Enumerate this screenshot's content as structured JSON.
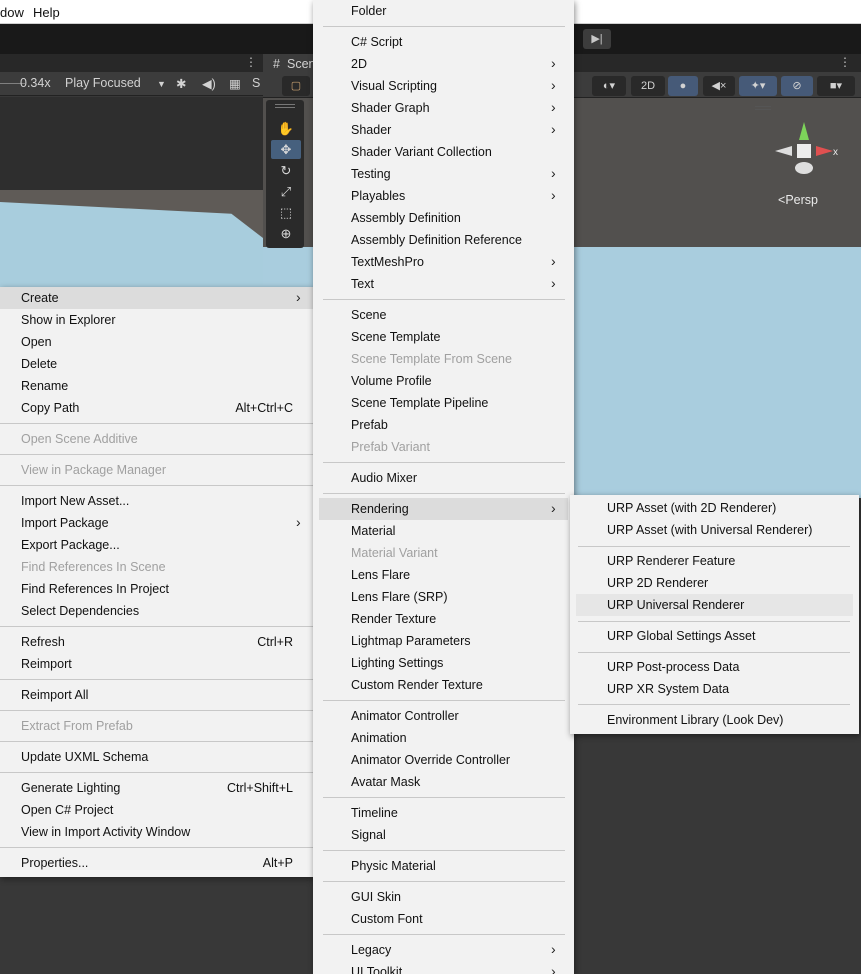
{
  "menubar": {
    "items": [
      "dow",
      "Help"
    ]
  },
  "game_view": {
    "scale": "0.34x",
    "play_mode": "Play Focused",
    "stats": "S"
  },
  "scene_view": {
    "tab": "Scen",
    "toggle_2d": "2D",
    "persp": "Persp",
    "axis_x": "x"
  },
  "left_menu": [
    {
      "label": "Create",
      "submenu": true,
      "highlight": true
    },
    {
      "label": "Show in Explorer"
    },
    {
      "label": "Open"
    },
    {
      "label": "Delete"
    },
    {
      "label": "Rename"
    },
    {
      "label": "Copy Path",
      "shortcut": "Alt+Ctrl+C"
    },
    {
      "label": "Open Scene Additive",
      "disabled": true
    },
    {
      "label": "View in Package Manager",
      "disabled": true
    },
    {
      "label": "Import New Asset..."
    },
    {
      "label": "Import Package",
      "submenu": true
    },
    {
      "label": "Export Package..."
    },
    {
      "label": "Find References In Scene",
      "disabled": true
    },
    {
      "label": "Find References In Project"
    },
    {
      "label": "Select Dependencies"
    },
    {
      "label": "Refresh",
      "shortcut": "Ctrl+R"
    },
    {
      "label": "Reimport"
    },
    {
      "label": "Reimport All"
    },
    {
      "label": "Extract From Prefab",
      "disabled": true
    },
    {
      "label": "Update UXML Schema"
    },
    {
      "label": "Generate Lighting",
      "shortcut": "Ctrl+Shift+L"
    },
    {
      "label": "Open C# Project"
    },
    {
      "label": "View in Import Activity Window"
    },
    {
      "label": "Properties...",
      "shortcut": "Alt+P"
    }
  ],
  "mid_menu": [
    {
      "label": "Folder"
    },
    {
      "label": "C# Script"
    },
    {
      "label": "2D",
      "submenu": true
    },
    {
      "label": "Visual Scripting",
      "submenu": true
    },
    {
      "label": "Shader Graph",
      "submenu": true
    },
    {
      "label": "Shader",
      "submenu": true
    },
    {
      "label": "Shader Variant Collection"
    },
    {
      "label": "Testing",
      "submenu": true
    },
    {
      "label": "Playables",
      "submenu": true
    },
    {
      "label": "Assembly Definition"
    },
    {
      "label": "Assembly Definition Reference"
    },
    {
      "label": "TextMeshPro",
      "submenu": true
    },
    {
      "label": "Text",
      "submenu": true
    },
    {
      "label": "Scene"
    },
    {
      "label": "Scene Template"
    },
    {
      "label": "Scene Template From Scene",
      "disabled": true
    },
    {
      "label": "Volume Profile"
    },
    {
      "label": "Scene Template Pipeline"
    },
    {
      "label": "Prefab"
    },
    {
      "label": "Prefab Variant",
      "disabled": true
    },
    {
      "label": "Audio Mixer"
    },
    {
      "label": "Rendering",
      "submenu": true,
      "highlight": true
    },
    {
      "label": "Material"
    },
    {
      "label": "Material Variant",
      "disabled": true
    },
    {
      "label": "Lens Flare"
    },
    {
      "label": "Lens Flare (SRP)"
    },
    {
      "label": "Render Texture"
    },
    {
      "label": "Lightmap Parameters"
    },
    {
      "label": "Lighting Settings"
    },
    {
      "label": "Custom Render Texture"
    },
    {
      "label": "Animator Controller"
    },
    {
      "label": "Animation"
    },
    {
      "label": "Animator Override Controller"
    },
    {
      "label": "Avatar Mask"
    },
    {
      "label": "Timeline"
    },
    {
      "label": "Signal"
    },
    {
      "label": "Physic Material"
    },
    {
      "label": "GUI Skin"
    },
    {
      "label": "Custom Font"
    },
    {
      "label": "Legacy",
      "submenu": true
    },
    {
      "label": "UI Toolkit",
      "submenu": true
    }
  ],
  "right_menu": [
    {
      "label": "URP Asset (with 2D Renderer)"
    },
    {
      "label": "URP Asset (with Universal Renderer)"
    },
    {
      "label": "URP Renderer Feature"
    },
    {
      "label": "URP 2D Renderer"
    },
    {
      "label": "URP Universal Renderer",
      "highlight": true
    },
    {
      "label": "URP Global Settings Asset"
    },
    {
      "label": "URP Post-process Data"
    },
    {
      "label": "URP XR System Data"
    },
    {
      "label": "Environment Library (Look Dev)"
    }
  ],
  "colors": {
    "menu_bg": "#f2f2f2",
    "highlight_box": "#e01010",
    "editor_dark": "#383838",
    "sky": "#a9cdde"
  }
}
